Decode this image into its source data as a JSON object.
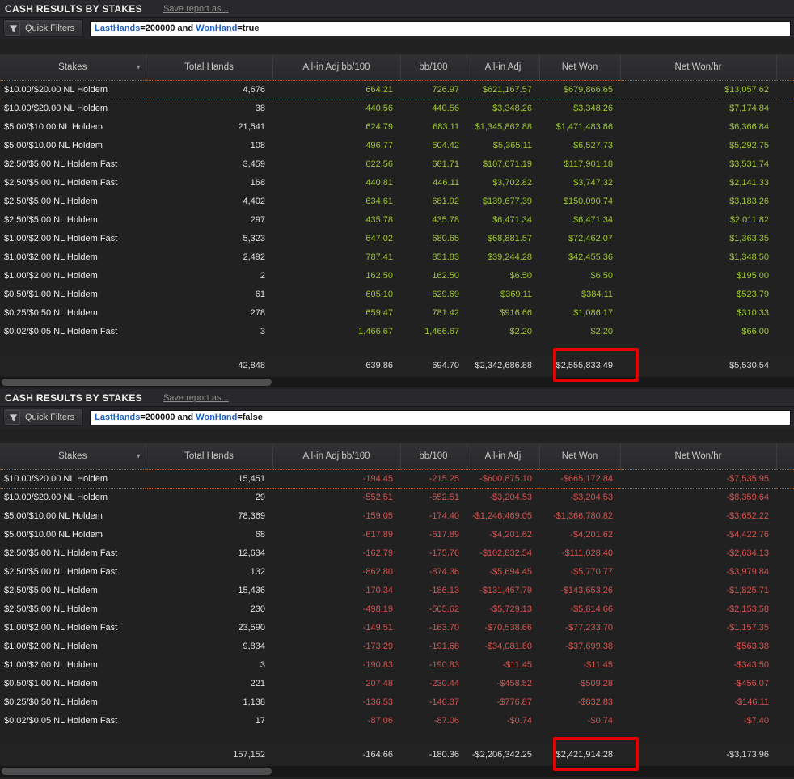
{
  "colors": {
    "positive_green": "#9dc62f",
    "negative_red": "#d4524e",
    "highlight_red": "#e60000",
    "filter_keyword_blue": "#1d5fbf",
    "dotted_line_orange": "#a55d1d"
  },
  "table": {
    "columns": [
      "Stakes",
      "Total Hands",
      "All-in Adj bb/100",
      "bb/100",
      "All-in Adj",
      "Net Won",
      "Net Won/hr"
    ],
    "column_keys": [
      "stakes",
      "hands",
      "aiadj_bb",
      "bb",
      "aiadj",
      "net",
      "hr"
    ]
  },
  "sections": [
    {
      "title": "CASH RESULTS BY STAKES",
      "save_link": "Save report as...",
      "quick_filters_label": "Quick Filters",
      "filter_segments": [
        {
          "text": "LastHands",
          "keyword": true
        },
        {
          "text": "=200000 and ",
          "keyword": false
        },
        {
          "text": "WonHand",
          "keyword": true
        },
        {
          "text": "=true",
          "keyword": false
        }
      ],
      "trend": "positive",
      "rows": [
        {
          "stakes": "$10.00/$20.00 NL Holdem",
          "hands": "4,676",
          "aiadj_bb": "664.21",
          "bb": "726.97",
          "aiadj": "$621,167.57",
          "net": "$679,866.65",
          "hr": "$13,057.62"
        },
        {
          "stakes": "$10.00/$20.00 NL Holdem",
          "hands": "38",
          "aiadj_bb": "440.56",
          "bb": "440.56",
          "aiadj": "$3,348.26",
          "net": "$3,348.26",
          "hr": "$7,174.84"
        },
        {
          "stakes": "$5.00/$10.00 NL Holdem",
          "hands": "21,541",
          "aiadj_bb": "624.79",
          "bb": "683.11",
          "aiadj": "$1,345,862.88",
          "net": "$1,471,483.86",
          "hr": "$6,366.84"
        },
        {
          "stakes": "$5.00/$10.00 NL Holdem",
          "hands": "108",
          "aiadj_bb": "496.77",
          "bb": "604.42",
          "aiadj": "$5,365.11",
          "net": "$6,527.73",
          "hr": "$5,292.75"
        },
        {
          "stakes": "$2.50/$5.00 NL Holdem Fast",
          "hands": "3,459",
          "aiadj_bb": "622.56",
          "bb": "681.71",
          "aiadj": "$107,671.19",
          "net": "$117,901.18",
          "hr": "$3,531.74"
        },
        {
          "stakes": "$2.50/$5.00 NL Holdem Fast",
          "hands": "168",
          "aiadj_bb": "440.81",
          "bb": "446.11",
          "aiadj": "$3,702.82",
          "net": "$3,747.32",
          "hr": "$2,141.33"
        },
        {
          "stakes": "$2.50/$5.00 NL Holdem",
          "hands": "4,402",
          "aiadj_bb": "634.61",
          "bb": "681.92",
          "aiadj": "$139,677.39",
          "net": "$150,090.74",
          "hr": "$3,183.26"
        },
        {
          "stakes": "$2.50/$5.00 NL Holdem",
          "hands": "297",
          "aiadj_bb": "435.78",
          "bb": "435.78",
          "aiadj": "$6,471.34",
          "net": "$6,471.34",
          "hr": "$2,011.82"
        },
        {
          "stakes": "$1.00/$2.00 NL Holdem Fast",
          "hands": "5,323",
          "aiadj_bb": "647.02",
          "bb": "680.65",
          "aiadj": "$68,881.57",
          "net": "$72,462.07",
          "hr": "$1,363.35"
        },
        {
          "stakes": "$1.00/$2.00 NL Holdem",
          "hands": "2,492",
          "aiadj_bb": "787.41",
          "bb": "851.83",
          "aiadj": "$39,244.28",
          "net": "$42,455.36",
          "hr": "$1,348.50"
        },
        {
          "stakes": "$1.00/$2.00 NL Holdem",
          "hands": "2",
          "aiadj_bb": "162.50",
          "bb": "162.50",
          "aiadj": "$6.50",
          "net": "$6.50",
          "hr": "$195.00"
        },
        {
          "stakes": "$0.50/$1.00 NL Holdem",
          "hands": "61",
          "aiadj_bb": "605.10",
          "bb": "629.69",
          "aiadj": "$369.11",
          "net": "$384.11",
          "hr": "$523.79"
        },
        {
          "stakes": "$0.25/$0.50 NL Holdem",
          "hands": "278",
          "aiadj_bb": "659.47",
          "bb": "781.42",
          "aiadj": "$916.66",
          "net": "$1,086.17",
          "hr": "$310.33"
        },
        {
          "stakes": "$0.02/$0.05 NL Holdem Fast",
          "hands": "3",
          "aiadj_bb": "1,466.67",
          "bb": "1,466.67",
          "aiadj": "$2.20",
          "net": "$2.20",
          "hr": "$66.00"
        }
      ],
      "totals": {
        "hands": "42,848",
        "aiadj_bb": "639.86",
        "bb": "694.70",
        "aiadj": "$2,342,686.88",
        "net": "$2,555,833.49",
        "hr": "$5,530.54"
      }
    },
    {
      "title": "CASH RESULTS BY STAKES",
      "save_link": "Save report as...",
      "quick_filters_label": "Quick Filters",
      "filter_segments": [
        {
          "text": "LastHands",
          "keyword": true
        },
        {
          "text": "=200000 and ",
          "keyword": false
        },
        {
          "text": "WonHand",
          "keyword": true
        },
        {
          "text": "=false",
          "keyword": false
        }
      ],
      "trend": "negative",
      "rows": [
        {
          "stakes": "$10.00/$20.00 NL Holdem",
          "hands": "15,451",
          "aiadj_bb": "-194.45",
          "bb": "-215.25",
          "aiadj": "-$600,875.10",
          "net": "-$665,172.84",
          "hr": "-$7,535.95"
        },
        {
          "stakes": "$10.00/$20.00 NL Holdem",
          "hands": "29",
          "aiadj_bb": "-552.51",
          "bb": "-552.51",
          "aiadj": "-$3,204.53",
          "net": "-$3,204.53",
          "hr": "-$8,359.64"
        },
        {
          "stakes": "$5.00/$10.00 NL Holdem",
          "hands": "78,369",
          "aiadj_bb": "-159.05",
          "bb": "-174.40",
          "aiadj": "-$1,246,469.05",
          "net": "-$1,366,780.82",
          "hr": "-$3,652.22"
        },
        {
          "stakes": "$5.00/$10.00 NL Holdem",
          "hands": "68",
          "aiadj_bb": "-617.89",
          "bb": "-617.89",
          "aiadj": "-$4,201.62",
          "net": "-$4,201.62",
          "hr": "-$4,422.76"
        },
        {
          "stakes": "$2.50/$5.00 NL Holdem Fast",
          "hands": "12,634",
          "aiadj_bb": "-162.79",
          "bb": "-175.76",
          "aiadj": "-$102,832.54",
          "net": "-$111,028.40",
          "hr": "-$2,634.13"
        },
        {
          "stakes": "$2.50/$5.00 NL Holdem Fast",
          "hands": "132",
          "aiadj_bb": "-862.80",
          "bb": "-874.36",
          "aiadj": "-$5,694.45",
          "net": "-$5,770.77",
          "hr": "-$3,979.84"
        },
        {
          "stakes": "$2.50/$5.00 NL Holdem",
          "hands": "15,436",
          "aiadj_bb": "-170.34",
          "bb": "-186.13",
          "aiadj": "-$131,467.79",
          "net": "-$143,653.26",
          "hr": "-$1,825.71"
        },
        {
          "stakes": "$2.50/$5.00 NL Holdem",
          "hands": "230",
          "aiadj_bb": "-498.19",
          "bb": "-505.62",
          "aiadj": "-$5,729.13",
          "net": "-$5,814.66",
          "hr": "-$2,153.58"
        },
        {
          "stakes": "$1.00/$2.00 NL Holdem Fast",
          "hands": "23,590",
          "aiadj_bb": "-149.51",
          "bb": "-163.70",
          "aiadj": "-$70,538.66",
          "net": "-$77,233.70",
          "hr": "-$1,157.35"
        },
        {
          "stakes": "$1.00/$2.00 NL Holdem",
          "hands": "9,834",
          "aiadj_bb": "-173.29",
          "bb": "-191.68",
          "aiadj": "-$34,081.80",
          "net": "-$37,699.38",
          "hr": "-$563.38"
        },
        {
          "stakes": "$1.00/$2.00 NL Holdem",
          "hands": "3",
          "aiadj_bb": "-190.83",
          "bb": "-190.83",
          "aiadj": "-$11.45",
          "net": "-$11.45",
          "hr": "-$343.50"
        },
        {
          "stakes": "$0.50/$1.00 NL Holdem",
          "hands": "221",
          "aiadj_bb": "-207.48",
          "bb": "-230.44",
          "aiadj": "-$458.52",
          "net": "-$509.28",
          "hr": "-$456.07"
        },
        {
          "stakes": "$0.25/$0.50 NL Holdem",
          "hands": "1,138",
          "aiadj_bb": "-136.53",
          "bb": "-146.37",
          "aiadj": "-$776.87",
          "net": "-$832.83",
          "hr": "-$146.11"
        },
        {
          "stakes": "$0.02/$0.05 NL Holdem Fast",
          "hands": "17",
          "aiadj_bb": "-87.06",
          "bb": "-87.06",
          "aiadj": "-$0.74",
          "net": "-$0.74",
          "hr": "-$7.40"
        }
      ],
      "totals": {
        "hands": "157,152",
        "aiadj_bb": "-164.66",
        "bb": "-180.36",
        "aiadj": "-$2,206,342.25",
        "net": "-$2,421,914.28",
        "hr": "-$3,173.96"
      }
    }
  ]
}
